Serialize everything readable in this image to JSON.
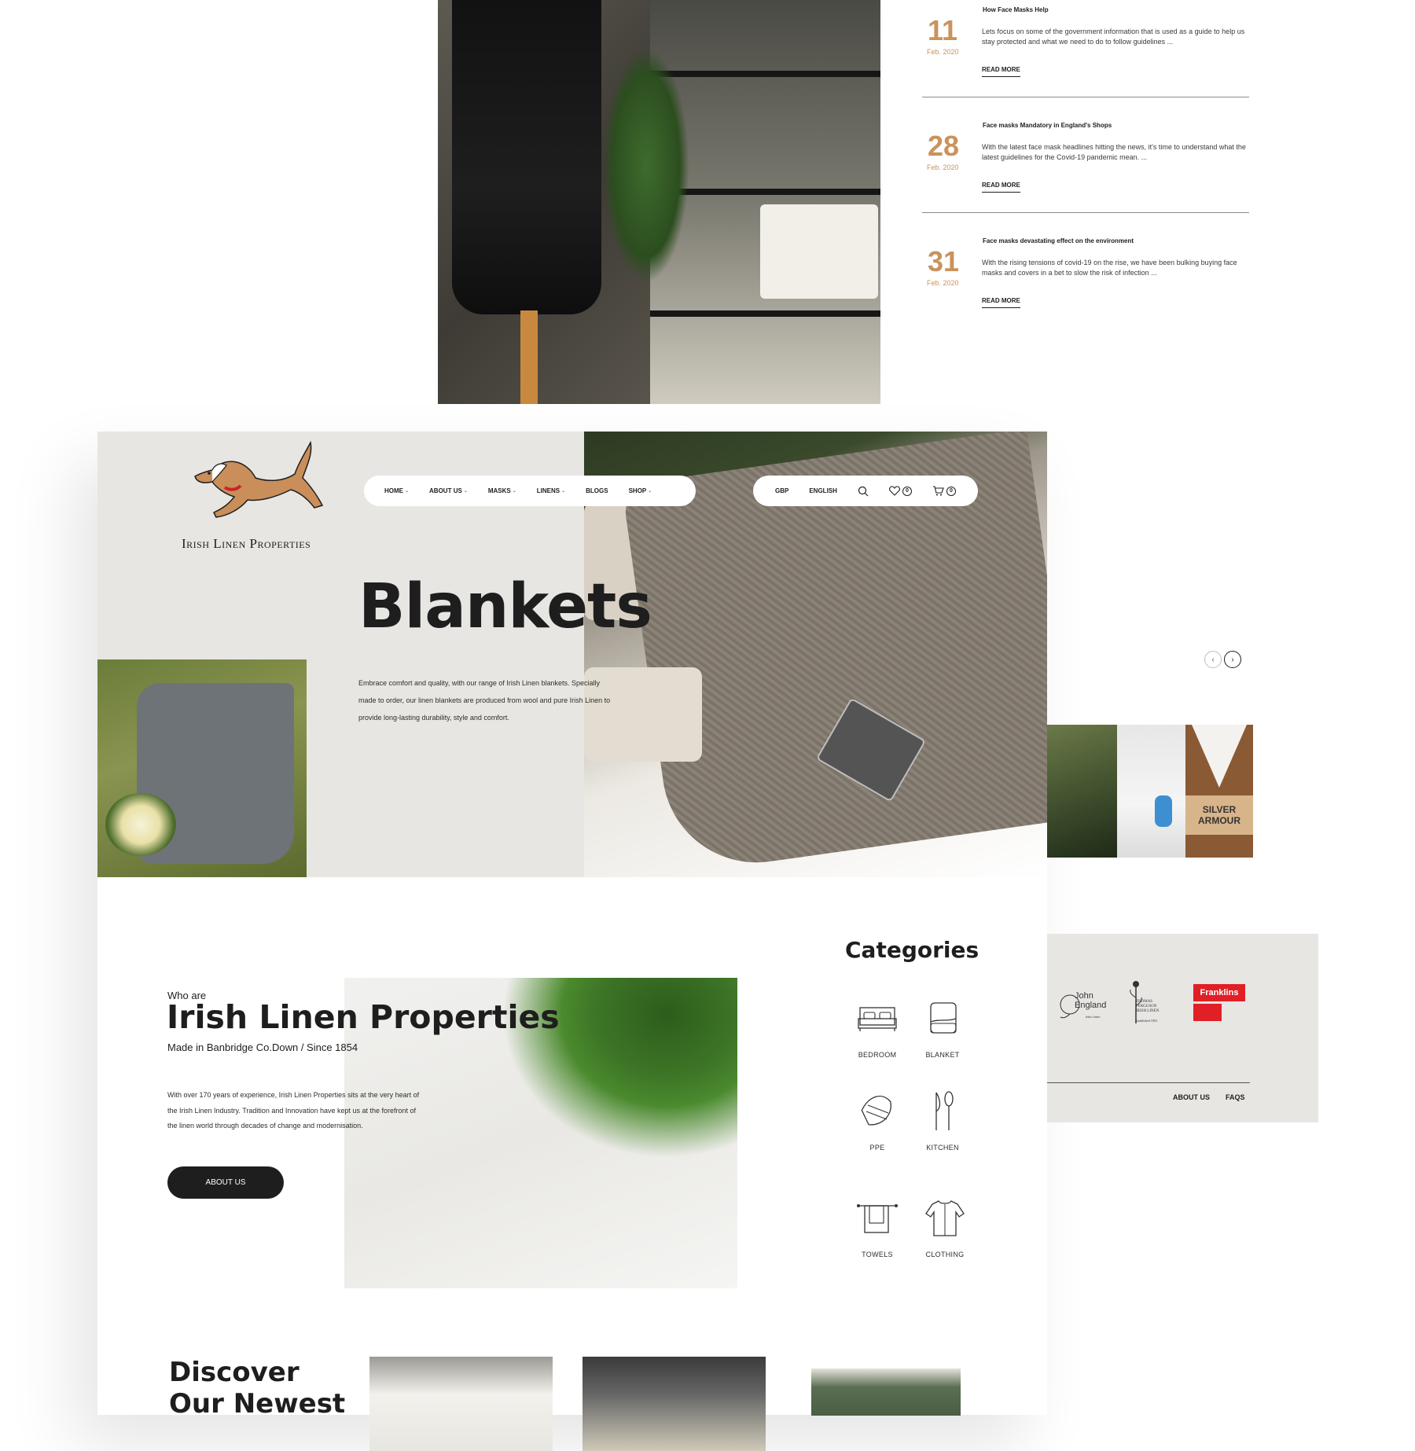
{
  "blog": {
    "posts": [
      {
        "day": "11",
        "month": "Feb. 2020",
        "title": "How Face Masks Help",
        "excerpt": "Lets focus on some of the government information that is used as a guide to help us stay protected and what we need to do to follow guidelines ...",
        "more": "READ MORE"
      },
      {
        "day": "28",
        "month": "Feb. 2020",
        "title": "Face masks Mandatory in England's Shops",
        "excerpt": "With the latest face mask headlines hitting the news, it's time to understand what the latest guidelines for the Covid-19 pandemic mean. ...",
        "more": "READ MORE"
      },
      {
        "day": "31",
        "month": "Feb. 2020",
        "title": "Face masks devastating effect on the environment",
        "excerpt": "With the rising tensions of covid-19 on the rise, we have been bulking buying face masks and covers in a bet to slow the risk of infection ...",
        "more": "READ MORE"
      }
    ]
  },
  "brand": {
    "name": "Irish Linen Properties"
  },
  "nav": {
    "items": [
      {
        "label": "HOME",
        "caret": true
      },
      {
        "label": "ABOUT US",
        "caret": true
      },
      {
        "label": "MASKS",
        "caret": true
      },
      {
        "label": "LINENS",
        "caret": true
      },
      {
        "label": "BLOGS",
        "caret": false
      },
      {
        "label": "SHOP",
        "caret": true
      }
    ]
  },
  "utility": {
    "currency": "GBP",
    "language": "ENGLISH",
    "wishlist_count": "0",
    "cart_count": "0"
  },
  "hero": {
    "title": "Blankets",
    "description": "Embrace comfort and quality, with our range of Irish Linen blankets. Specially made to order, our linen blankets are produced from wool and pure Irish Linen to provide long-lasting durability, style and comfort.",
    "prev_glyph": "‹",
    "next_glyph": "›",
    "thumb_sign": "SILVER ARMOUR"
  },
  "footer": {
    "brands": {
      "john": "John England",
      "john_sub": "Irish Linen",
      "thomas": "THOMAS FERGUSON IRISH LINEN",
      "thomas_sub": "established 1854",
      "franklins": "Franklins"
    },
    "links": [
      "ABOUT US",
      "FAQS"
    ]
  },
  "about": {
    "kicker": "Who are",
    "title": "Irish Linen Properties",
    "subtitle": "Made in Banbridge Co.Down / Since 1854",
    "body": "With over 170 years of experience, Irish Linen Properties sits at the very heart of the Irish Linen Industry. Tradition and Innovation have kept us at the forefront of the linen world through decades of change and modernisation.",
    "button": "ABOUT US"
  },
  "categories": {
    "title": "Categories",
    "items": [
      {
        "label": "BEDROOM",
        "icon": "bed-icon"
      },
      {
        "label": "BLANKET",
        "icon": "blanket-icon"
      },
      {
        "label": "PPE",
        "icon": "face-mask-icon"
      },
      {
        "label": "KITCHEN",
        "icon": "cutlery-icon"
      },
      {
        "label": "TOWELS",
        "icon": "towel-icon"
      },
      {
        "label": "CLOTHING",
        "icon": "shirt-icon"
      }
    ]
  },
  "discover": {
    "title": "Discover Our Newest"
  },
  "colors": {
    "accent": "#c9935c",
    "hero_bg": "#e7e6e3",
    "dark": "#1e1e1e",
    "franklins_red": "#e01f26"
  }
}
